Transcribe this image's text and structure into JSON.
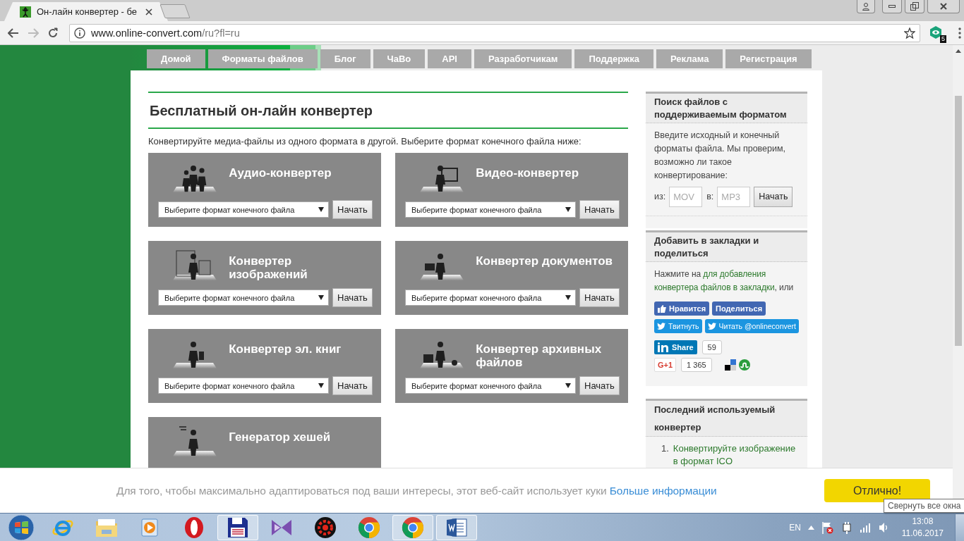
{
  "browser": {
    "tab_title": "Он-лайн конвертер - бе",
    "url_host": "www.online-convert.com",
    "url_path": "/ru?fl=ru",
    "extension_badge": "5"
  },
  "nav": [
    "Домой",
    "Форматы файлов",
    "Блог",
    "ЧаВо",
    "API",
    "Разработчикам",
    "Поддержка",
    "Реклама",
    "Регистрация"
  ],
  "main": {
    "title": "Бесплатный он-лайн конвертер",
    "intro": "Конвертируйте медиа-файлы из одного формата в другой. Выберите формат конечного файла ниже:",
    "cards": [
      {
        "title": "Аудио-конвертер",
        "select": "Выберите формат конечного файла",
        "button": "Начать"
      },
      {
        "title": "Видео-конвертер",
        "select": "Выберите формат конечного файла",
        "button": "Начать"
      },
      {
        "title": "Конвертер изображений",
        "select": "Выберите формат конечного файла",
        "button": "Начать"
      },
      {
        "title": "Конвертер документов",
        "select": "Выберите формат конечного файла",
        "button": "Начать"
      },
      {
        "title": "Конвертер эл. книг",
        "select": "Выберите формат конечного файла",
        "button": "Начать"
      },
      {
        "title": "Конвертер архивных файлов",
        "select": "Выберите формат конечного файла",
        "button": "Начать"
      },
      {
        "title": "Генератор хешей"
      }
    ]
  },
  "sidebar": {
    "search": {
      "title": "Поиск файлов с поддерживаемым форматом",
      "text": "Введите исходный и конечный форматы файла. Мы проверим, возможно ли такое конвертирование:",
      "from_label": "из:",
      "from_placeholder": "MOV",
      "to_label": "в:",
      "to_placeholder": "MP3",
      "button": "Начать"
    },
    "share": {
      "title": "Добавить в закладки и поделиться",
      "text_before": "Нажмите на",
      "link_parts": [
        "для добавления",
        "конвертера файлов в закладки"
      ],
      "text_after": ", или",
      "like": "Нравится",
      "fb_share": "Поделиться",
      "tweet": "Твитнуть",
      "follow": "Читать @onlineconvert",
      "linkedin": "Share",
      "linkedin_count": "59",
      "gplus": "G+1",
      "gplus_count": "1 365"
    },
    "recent": {
      "title": "Последний используемый конвертер",
      "items": [
        {
          "number": "1.",
          "label": "Конвертируйте изображение в формат ICO"
        }
      ]
    }
  },
  "cookie": {
    "text": "Для того, чтобы максимально адаптироваться под ваши интересы, этот веб-сайт использует куки",
    "link": "Больше информации",
    "button": "Отлично!"
  },
  "tooltip": "Свернуть все окна",
  "taskbar": {
    "apps": [
      {
        "kind": "ie",
        "active": false
      },
      {
        "kind": "explorer",
        "active": false
      },
      {
        "kind": "media",
        "active": false
      },
      {
        "kind": "opera",
        "active": false
      },
      {
        "kind": "save",
        "active": true
      },
      {
        "kind": "vs",
        "active": false
      },
      {
        "kind": "driver",
        "active": false
      },
      {
        "kind": "chrome",
        "active": false
      },
      {
        "kind": "chrome",
        "active": true
      },
      {
        "kind": "word",
        "active": true
      }
    ],
    "language": "EN",
    "time": "13:08",
    "date": "11.06.2017"
  }
}
